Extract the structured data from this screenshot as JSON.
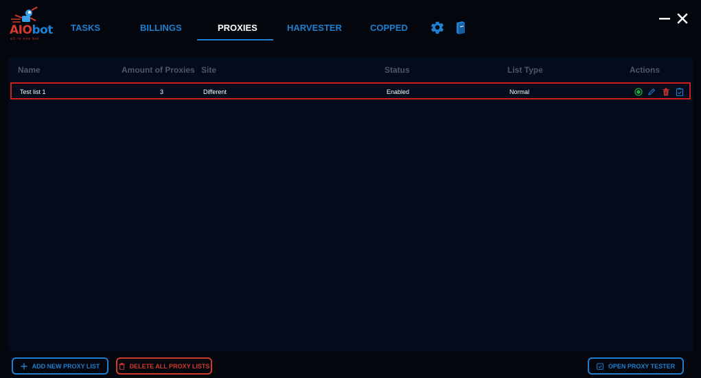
{
  "app": {
    "logo_text_red": "AIO",
    "logo_text_blue": "bot",
    "logo_tagline": "all in one bot"
  },
  "nav": {
    "tabs": [
      {
        "label": "TASKS",
        "active": false
      },
      {
        "label": "BILLINGS",
        "active": false
      },
      {
        "label": "PROXIES",
        "active": true
      },
      {
        "label": "HARVESTER",
        "active": false
      },
      {
        "label": "COPPED",
        "active": false
      }
    ],
    "icons": [
      "gear-icon",
      "book-icon"
    ]
  },
  "window_controls": [
    "minimize-icon",
    "close-icon"
  ],
  "table": {
    "columns": [
      "Name",
      "Amount of Proxies",
      "Site",
      "Status",
      "List Type",
      "Actions"
    ],
    "rows": [
      {
        "name": "Test list 1",
        "amount": "3",
        "site": "Different",
        "status": "Enabled",
        "list_type": "Normal",
        "actions": [
          "status-toggle-icon",
          "edit-icon",
          "delete-icon",
          "clipboard-check-icon"
        ]
      }
    ]
  },
  "footer": {
    "add_label": "ADD NEW PROXY LIST",
    "delete_all_label": "DELETE ALL PROXY LISTS",
    "tester_label": "OPEN PROXY TESTER"
  },
  "colors": {
    "accent": "#1f7fd0",
    "danger": "#d33a2c",
    "success": "#21a83c",
    "background": "#03070d",
    "panel": "#020c1c",
    "header_text": "#4f5864"
  }
}
